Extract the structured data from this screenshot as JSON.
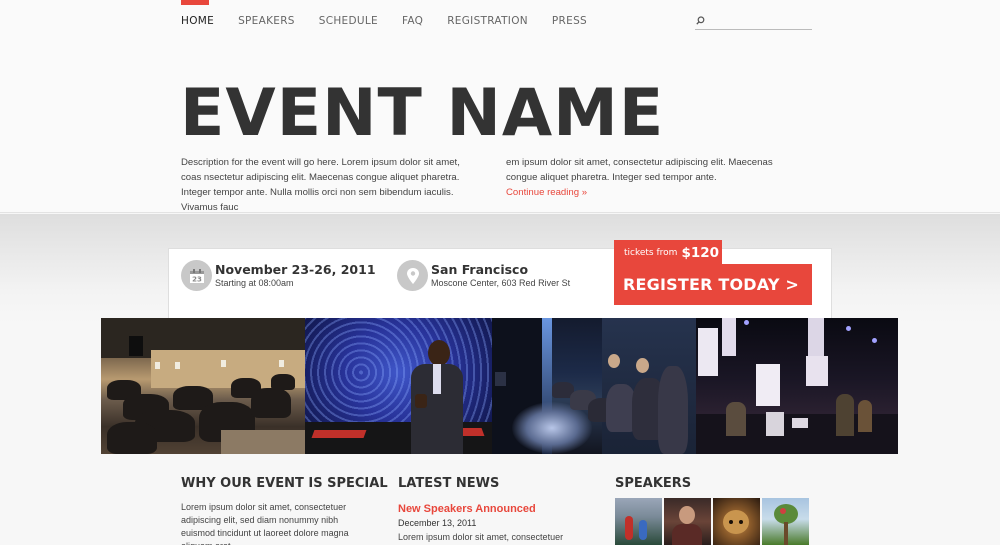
{
  "nav": {
    "items": [
      {
        "label": "HOME",
        "active": true
      },
      {
        "label": "SPEAKERS"
      },
      {
        "label": "SCHEDULE"
      },
      {
        "label": "FAQ"
      },
      {
        "label": "REGISTRATION"
      },
      {
        "label": "PRESS"
      }
    ],
    "search_icon": "search-icon"
  },
  "hero": {
    "title": "EVENT NAME",
    "desc_col1": "Description for the event will go here. Lorem ipsum dolor sit amet, coas nsectetur adipiscing elit. Maecenas congue aliquet pharetra. Integer tempor ante. Nulla mollis orci non sem bibendum iaculis. Vivamus fauc",
    "desc_col2": "em ipsum dolor sit amet, consectetur adipiscing elit. Maecenas congue aliquet pharetra. Integer sed tempor ante.",
    "continue_link": "Continue reading »"
  },
  "info": {
    "date_main": "November 23-26, 2011",
    "date_sub": "Starting at 08:00am",
    "date_icon": "calendar-icon",
    "place_main": "San Francisco",
    "place_sub": "Moscone Center, 603 Red River St",
    "place_icon": "map-pin-icon",
    "tickets_label": "tickets from",
    "tickets_price": "$120",
    "register_label": "REGISTER TODAY >"
  },
  "photos": [
    "conference-audience-photo",
    "speaker-on-stage-photo",
    "seated-audience-photo",
    "stage-performance-photo"
  ],
  "columns": {
    "special": {
      "heading": "WHY OUR EVENT IS SPECIAL",
      "text": "Lorem ipsum dolor sit amet, consectetuer adipiscing elit, sed diam nonummy nibh euismod tincidunt ut laoreet dolore magna aliquam erat"
    },
    "news": {
      "heading": "LATEST NEWS",
      "item_title": "New Speakers Announced",
      "item_date": "December 13, 2011",
      "item_text": "Lorem ipsum dolor sit amet, consectetuer adipiscing"
    },
    "speakers": {
      "heading": "SPEAKERS",
      "thumbs": [
        "speaker-photo-1",
        "speaker-photo-2",
        "speaker-photo-3",
        "speaker-photo-4"
      ]
    }
  },
  "colors": {
    "accent": "#e8473c",
    "text": "#333333",
    "background": "#f7f7f7"
  }
}
